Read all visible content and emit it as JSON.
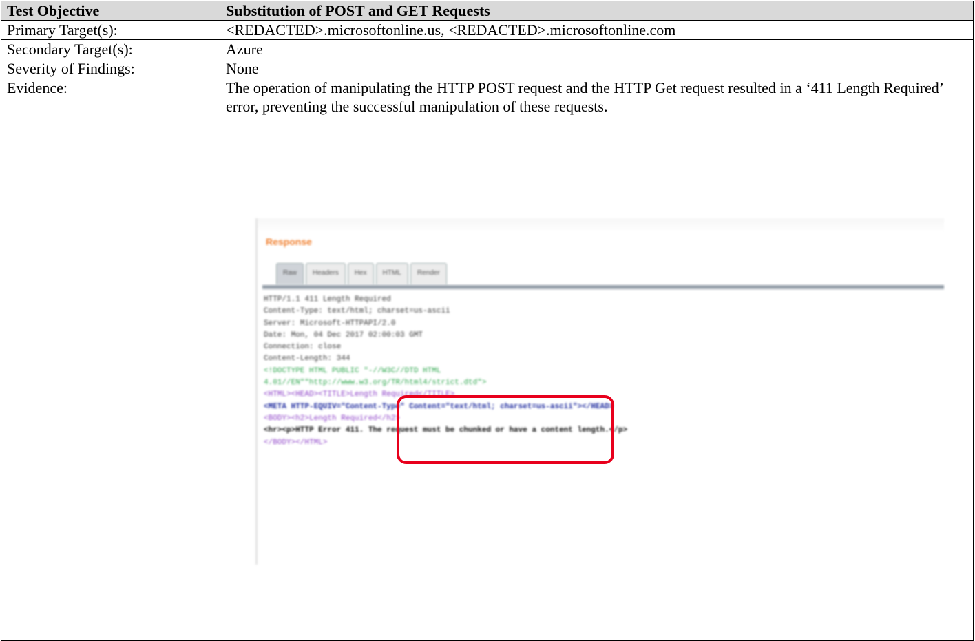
{
  "table": {
    "header": {
      "label": "Test Objective",
      "value": "Substitution of POST and GET Requests"
    },
    "rows": [
      {
        "label": "Primary Target(s):",
        "value": "<REDACTED>.microsoftonline.us, <REDACTED>.microsoftonline.com"
      },
      {
        "label": "Secondary Target(s):",
        "value": "Azure"
      },
      {
        "label": "Severity of Findings:",
        "value": "None"
      }
    ],
    "evidence": {
      "label": "Evidence:",
      "text": "The operation of manipulating the HTTP POST request and the HTTP Get request resulted in a ‘411 Length Required’ error, preventing the successful manipulation of these requests."
    }
  },
  "screenshot": {
    "title": "Response",
    "tabs": [
      "Raw",
      "Headers",
      "Hex",
      "HTML",
      "Render"
    ],
    "active_tab": "Raw",
    "highlight_color": "#e8001c",
    "code_lines": [
      "HTTP/1.1 411 Length Required",
      "Content-Type: text/html; charset=us-ascii",
      "Server: Microsoft-HTTPAPI/2.0",
      "Date: Mon, 04 Dec 2017 02:00:03 GMT",
      "Connection: close",
      "Content-Length: 344",
      "",
      "<!DOCTYPE HTML PUBLIC \"-//W3C//DTD HTML",
      "4.01//EN\"\"http://www.w3.org/TR/html4/strict.dtd\">",
      "<HTML><HEAD><TITLE>Length Required</TITLE>",
      "<META HTTP-EQUIV=\"Content-Type\" Content=\"text/html; charset=us-ascii\"></HEAD>",
      "<BODY><h2>Length Required</h2>",
      "<hr><p>HTTP Error 411. The request must be chunked or have a content length.</p>",
      "</BODY></HTML>"
    ]
  }
}
